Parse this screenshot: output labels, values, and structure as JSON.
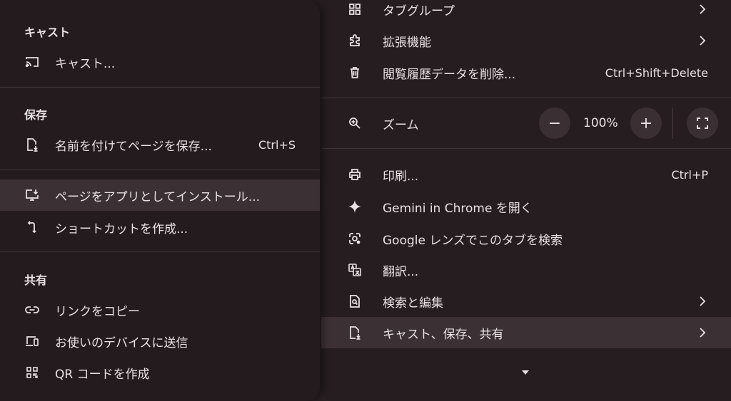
{
  "main_menu": {
    "items_top": [
      {
        "label": "タブグループ",
        "icon": "tab-groups-icon",
        "submenu": true,
        "shortcut": ""
      },
      {
        "label": "拡張機能",
        "icon": "extensions-icon",
        "submenu": true,
        "shortcut": ""
      },
      {
        "label": "閲覧履歴データを削除...",
        "icon": "trash-icon",
        "submenu": false,
        "shortcut": "Ctrl+Shift+Delete"
      }
    ],
    "zoom": {
      "label": "ズーム",
      "value": "100%",
      "minus": "−",
      "plus": "+"
    },
    "items_bottom": [
      {
        "label": "印刷...",
        "icon": "print-icon",
        "submenu": false,
        "shortcut": "Ctrl+P"
      },
      {
        "label": "Gemini in Chrome を開く",
        "icon": "gemini-sparkle-icon",
        "submenu": false,
        "shortcut": ""
      },
      {
        "label": "Google レンズでこのタブを検索",
        "icon": "google-lens-icon",
        "submenu": false,
        "shortcut": ""
      },
      {
        "label": "翻訳...",
        "icon": "translate-icon",
        "submenu": false,
        "shortcut": ""
      },
      {
        "label": "検索と編集",
        "icon": "find-edit-icon",
        "submenu": true,
        "shortcut": ""
      },
      {
        "label": "キャスト、保存、共有",
        "icon": "cast-save-share-icon",
        "submenu": true,
        "shortcut": "",
        "highlighted": true
      }
    ]
  },
  "sub_menu": {
    "sections": [
      {
        "header": "キャスト",
        "items": [
          {
            "label": "キャスト...",
            "icon": "cast-icon",
            "shortcut": ""
          }
        ]
      },
      {
        "header": "保存",
        "items": [
          {
            "label": "名前を付けてページを保存...",
            "icon": "save-page-icon",
            "shortcut": "Ctrl+S"
          }
        ]
      },
      {
        "header": "",
        "items": [
          {
            "label": "ページをアプリとしてインストール...",
            "icon": "install-app-icon",
            "shortcut": "",
            "highlighted": true
          },
          {
            "label": "ショートカットを作成...",
            "icon": "create-shortcut-icon",
            "shortcut": ""
          }
        ]
      },
      {
        "header": "共有",
        "items": [
          {
            "label": "リンクをコピー",
            "icon": "link-icon",
            "shortcut": ""
          },
          {
            "label": "お使いのデバイスに送信",
            "icon": "send-to-devices-icon",
            "shortcut": ""
          },
          {
            "label": "QR コードを作成",
            "icon": "qr-code-icon",
            "shortcut": ""
          }
        ]
      }
    ]
  },
  "colors": {
    "menu_bg": "#261d20",
    "highlight": "#3b3034",
    "text": "#e8e2e4"
  }
}
